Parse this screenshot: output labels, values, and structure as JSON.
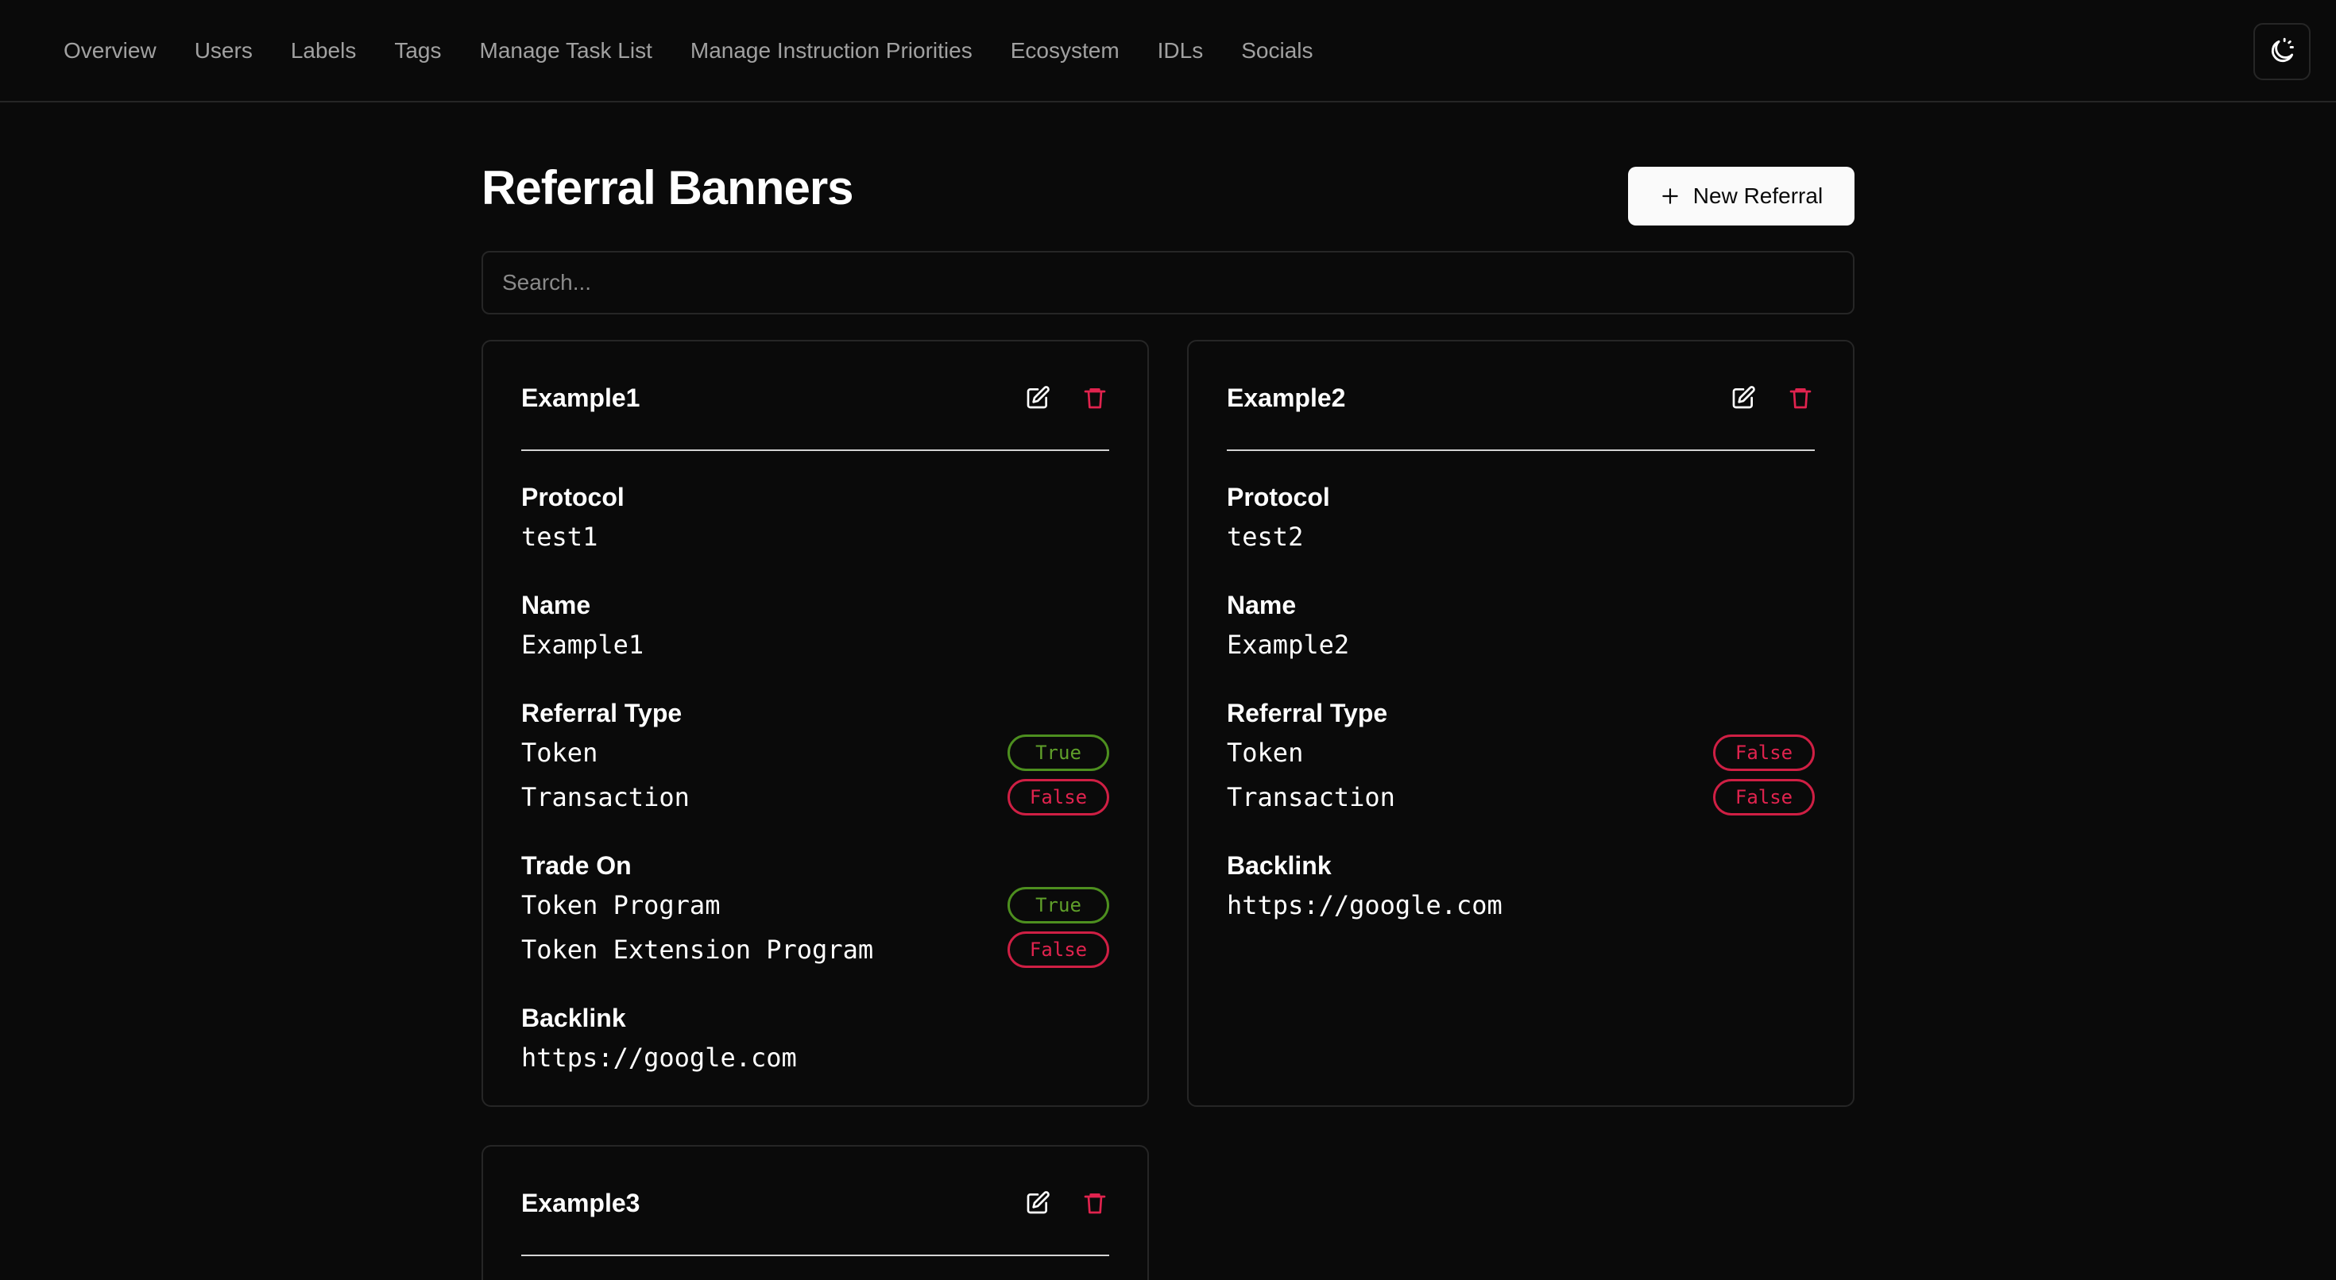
{
  "nav": {
    "items": [
      "Overview",
      "Users",
      "Labels",
      "Tags",
      "Manage Task List",
      "Manage Instruction Priorities",
      "Ecosystem",
      "IDLs",
      "Socials"
    ],
    "theme_icon": "moon-sun-icon"
  },
  "page": {
    "title": "Referral Banners",
    "new_button_label": "New Referral",
    "search_placeholder": "Search..."
  },
  "colors": {
    "background": "#0a0a0a",
    "border": "#262626",
    "true_badge": "#4d8f1f",
    "false_badge": "#cf1f44",
    "delete_icon": "#e0234e"
  },
  "cards": [
    {
      "title": "Example1",
      "protocol_label": "Protocol",
      "protocol": "test1",
      "name_label": "Name",
      "name": "Example1",
      "referral_type_label": "Referral Type",
      "token_label": "Token",
      "token_value": "True",
      "transaction_label": "Transaction",
      "transaction_value": "False",
      "trade_on_label": "Trade On",
      "token_program_label": "Token Program",
      "token_program_value": "True",
      "token_ext_label": "Token Extension Program",
      "token_ext_value": "False",
      "backlink_label": "Backlink",
      "backlink": "https://google.com"
    },
    {
      "title": "Example2",
      "protocol_label": "Protocol",
      "protocol": "test2",
      "name_label": "Name",
      "name": "Example2",
      "referral_type_label": "Referral Type",
      "token_label": "Token",
      "token_value": "False",
      "transaction_label": "Transaction",
      "transaction_value": "False",
      "backlink_label": "Backlink",
      "backlink": "https://google.com"
    },
    {
      "title": "Example3"
    }
  ]
}
